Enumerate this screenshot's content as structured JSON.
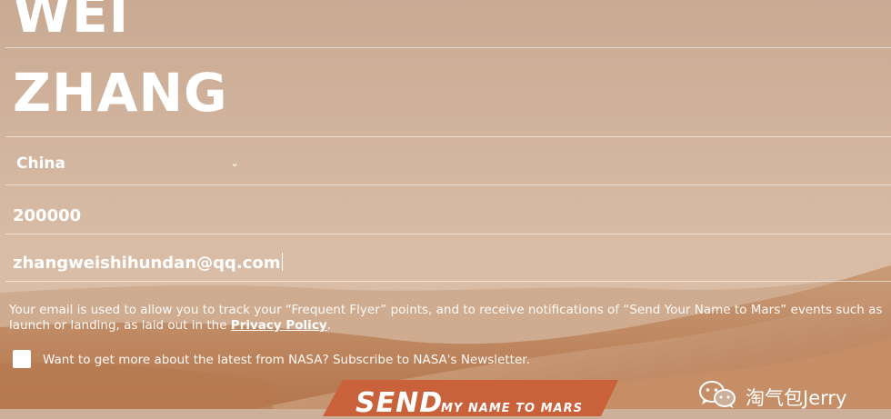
{
  "form": {
    "first_name": "WEI",
    "last_name": "ZHANG",
    "country": "China",
    "postal_code": "200000",
    "email": "zhangweishihundan@qq.com"
  },
  "disclaimer": {
    "text_before": "Your email is used to allow you to track your “Frequent Flyer” points, and to receive notifications of “Send Your Name to Mars” events such as launch or landing, as laid out in the ",
    "link": "Privacy Policy",
    "text_after": "."
  },
  "newsletter": {
    "label": "Want to get more about the latest from NASA? Subscribe to NASA's Newsletter.",
    "checked": false
  },
  "send_button": {
    "main": "SEND",
    "sub": "MY NAME TO MARS",
    "color": "#c9623a"
  },
  "watermark": {
    "text": "淘气包Jerry",
    "icon": "wechat-icon"
  }
}
